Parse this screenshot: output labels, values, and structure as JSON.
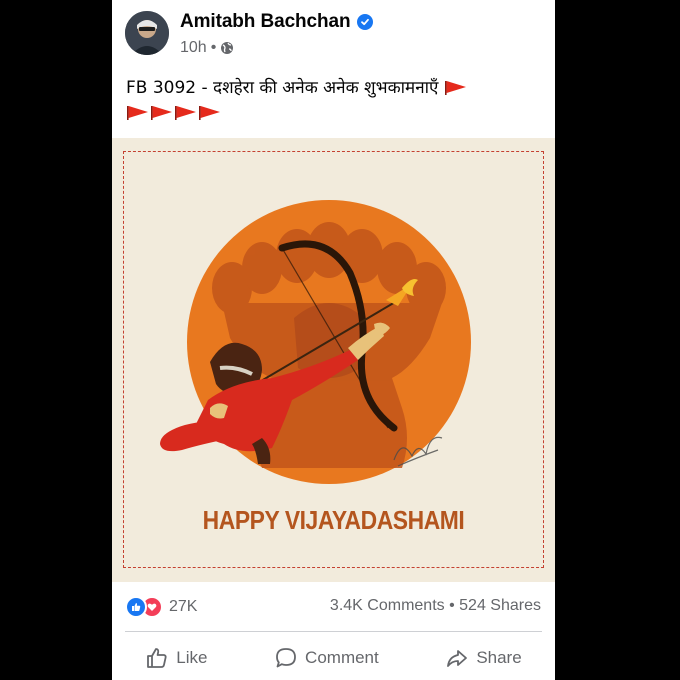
{
  "post": {
    "author": "Amitabh Bachchan",
    "time": "10h",
    "separator": "•",
    "caption": "FB 3092 - दशहेरा की अनेक अनेक शुभकामनाएँ",
    "caption_flag_count": 5,
    "image": {
      "greeting": "HAPPY VIJAYADASHAMI",
      "colors": {
        "background": "#f2ebdc",
        "sun": "#e8781f",
        "border": "#c44030",
        "figure": "#d82a1e",
        "greeting": "#b4551e"
      }
    },
    "stats": {
      "reaction_count": "27K",
      "comments": "3.4K Comments",
      "shares": "524 Shares",
      "dot": "•"
    },
    "actions": {
      "like": "Like",
      "comment": "Comment",
      "share": "Share"
    },
    "icons": {
      "verified": "verified-badge-icon",
      "audience": "globe-icon",
      "flag": "red-pennant-flag-icon",
      "like": "thumbs-up-icon",
      "love": "heart-icon",
      "comment": "speech-bubble-icon",
      "share": "share-arrow-icon"
    }
  }
}
